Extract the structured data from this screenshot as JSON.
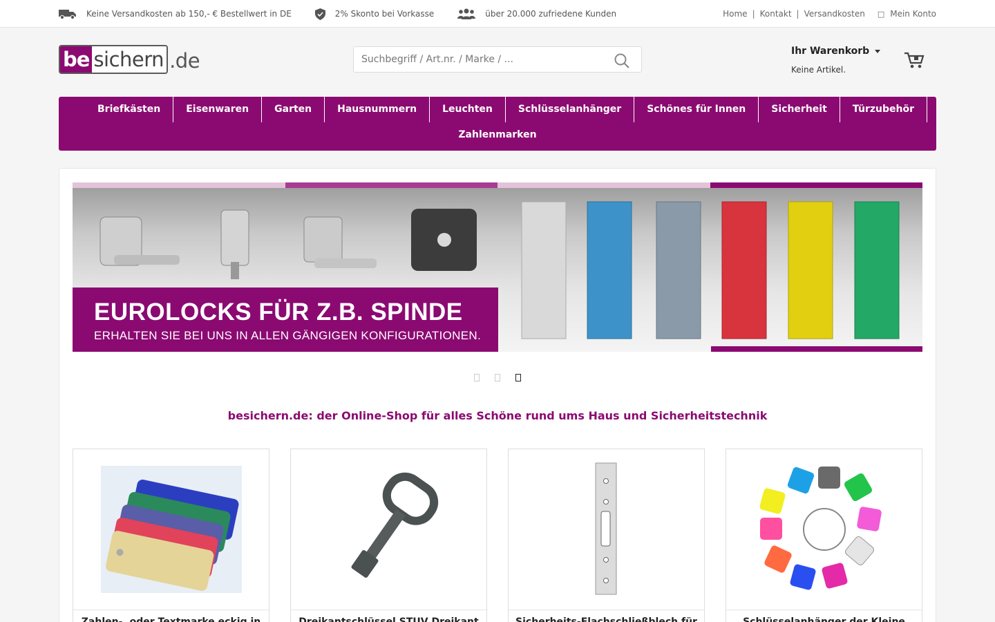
{
  "topbar": {
    "usp": [
      {
        "icon": "truck-icon",
        "text": "Keine Versandkosten ab 150,- € Bestellwert in DE"
      },
      {
        "icon": "shield-icon",
        "text": "2% Skonto bei Vorkasse"
      },
      {
        "icon": "users-icon",
        "text": "über 20.000 zufriedene Kunden"
      }
    ],
    "links": {
      "home": "Home",
      "kontakt": "Kontakt",
      "versandkosten": "Versandkosten",
      "account": "Mein Konto",
      "separator": "|"
    }
  },
  "header": {
    "logo": {
      "part1": "be",
      "part2": "sichern",
      "part3": ".de"
    },
    "search_placeholder": "Suchbegriff / Art.nr. / Marke / ...",
    "cart_title": "Ihr Warenkorb",
    "cart_status": "Keine Artikel."
  },
  "nav": {
    "row1": [
      "Briefkästen",
      "Eisenwaren",
      "Garten",
      "Hausnummern",
      "Leuchten",
      "Schlüsselanhänger",
      "Schönes für Innen",
      "Sicherheit",
      "Türzubehör"
    ],
    "row2": [
      "Zahlenmarken"
    ]
  },
  "banner": {
    "title": "EUROLOCKS FÜR Z.B. SPINDE",
    "subtitle": "ERHALTEN SIE BEI UNS IN ALLEN GÄNGIGEN KONFIGURATIONEN.",
    "slides": 3,
    "active_slide": 3
  },
  "slogan": "besichern.de: der Online-Shop für alles Schöne rund ums Haus und Sicherheitstechnik",
  "products": [
    {
      "title": "Zahlen-, oder Textmarke eckig in"
    },
    {
      "title": "Dreikantschlüssel STUV Dreikant"
    },
    {
      "title": "Sicherheits-Flachschließblech für"
    },
    {
      "title": "Schlüsselanhänger der Kleine"
    }
  ],
  "colors": {
    "brand": "#8b0a71"
  }
}
